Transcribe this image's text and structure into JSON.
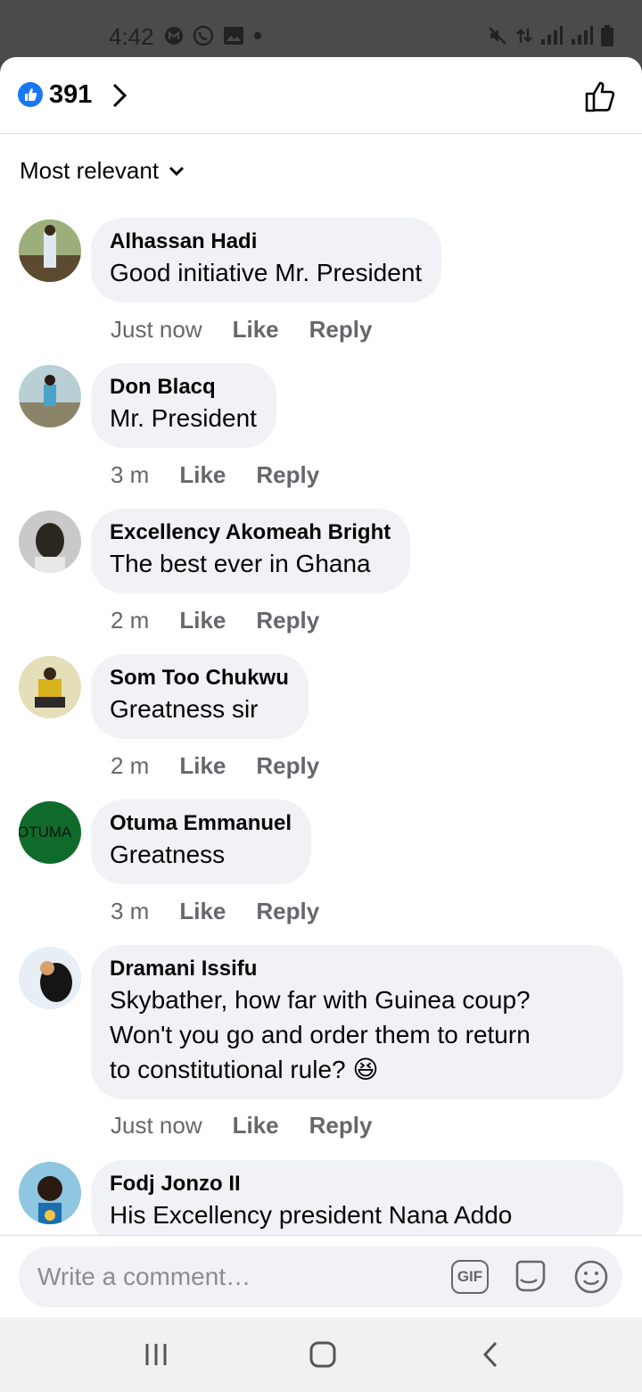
{
  "status_bar": {
    "time": "4:42"
  },
  "reactions": {
    "like_count": "391"
  },
  "sort": {
    "label": "Most relevant"
  },
  "comments": [
    {
      "name": "Alhassan Hadi",
      "text": "Good initiative Mr. President",
      "time": "Just now",
      "like": "Like",
      "reply": "Reply",
      "avatar_color": "#6b7a55"
    },
    {
      "name": "Don Blacq",
      "text": "Mr. President",
      "time": "3 m",
      "like": "Like",
      "reply": "Reply",
      "avatar_color": "#8aa0a8"
    },
    {
      "name": "Excellency Akomeah Bright",
      "text": "The best ever in Ghana",
      "time": "2 m",
      "like": "Like",
      "reply": "Reply",
      "avatar_color": "#7a7a7a"
    },
    {
      "name": "Som Too Chukwu",
      "text": "Greatness sir",
      "time": "2 m",
      "like": "Like",
      "reply": "Reply",
      "avatar_color": "#d9d4a8"
    },
    {
      "name": "Otuma Emmanuel",
      "text": "Greatness",
      "time": "3 m",
      "like": "Like",
      "reply": "Reply",
      "avatar_color": "#0e6b2b",
      "avatar_text": "OTUMA"
    },
    {
      "name": "Dramani Issifu",
      "text_lines": [
        "Skybather, how far with Guinea coup?",
        "Won't you go and order them to return",
        "to constitutional rule? 😆"
      ],
      "time": "Just now",
      "like": "Like",
      "reply": "Reply",
      "avatar_color": "#9fb3c8"
    },
    {
      "name": "Fodj Jonzo II",
      "text": "His Excellency president Nana Addo",
      "avatar_color": "#7fb8d8"
    }
  ],
  "composer": {
    "placeholder": "Write a comment…",
    "gif_label": "GIF"
  },
  "colors": {
    "brand_blue": "#1877f2",
    "bubble": "#f0f2f5",
    "meta_gray": "#65676b"
  }
}
